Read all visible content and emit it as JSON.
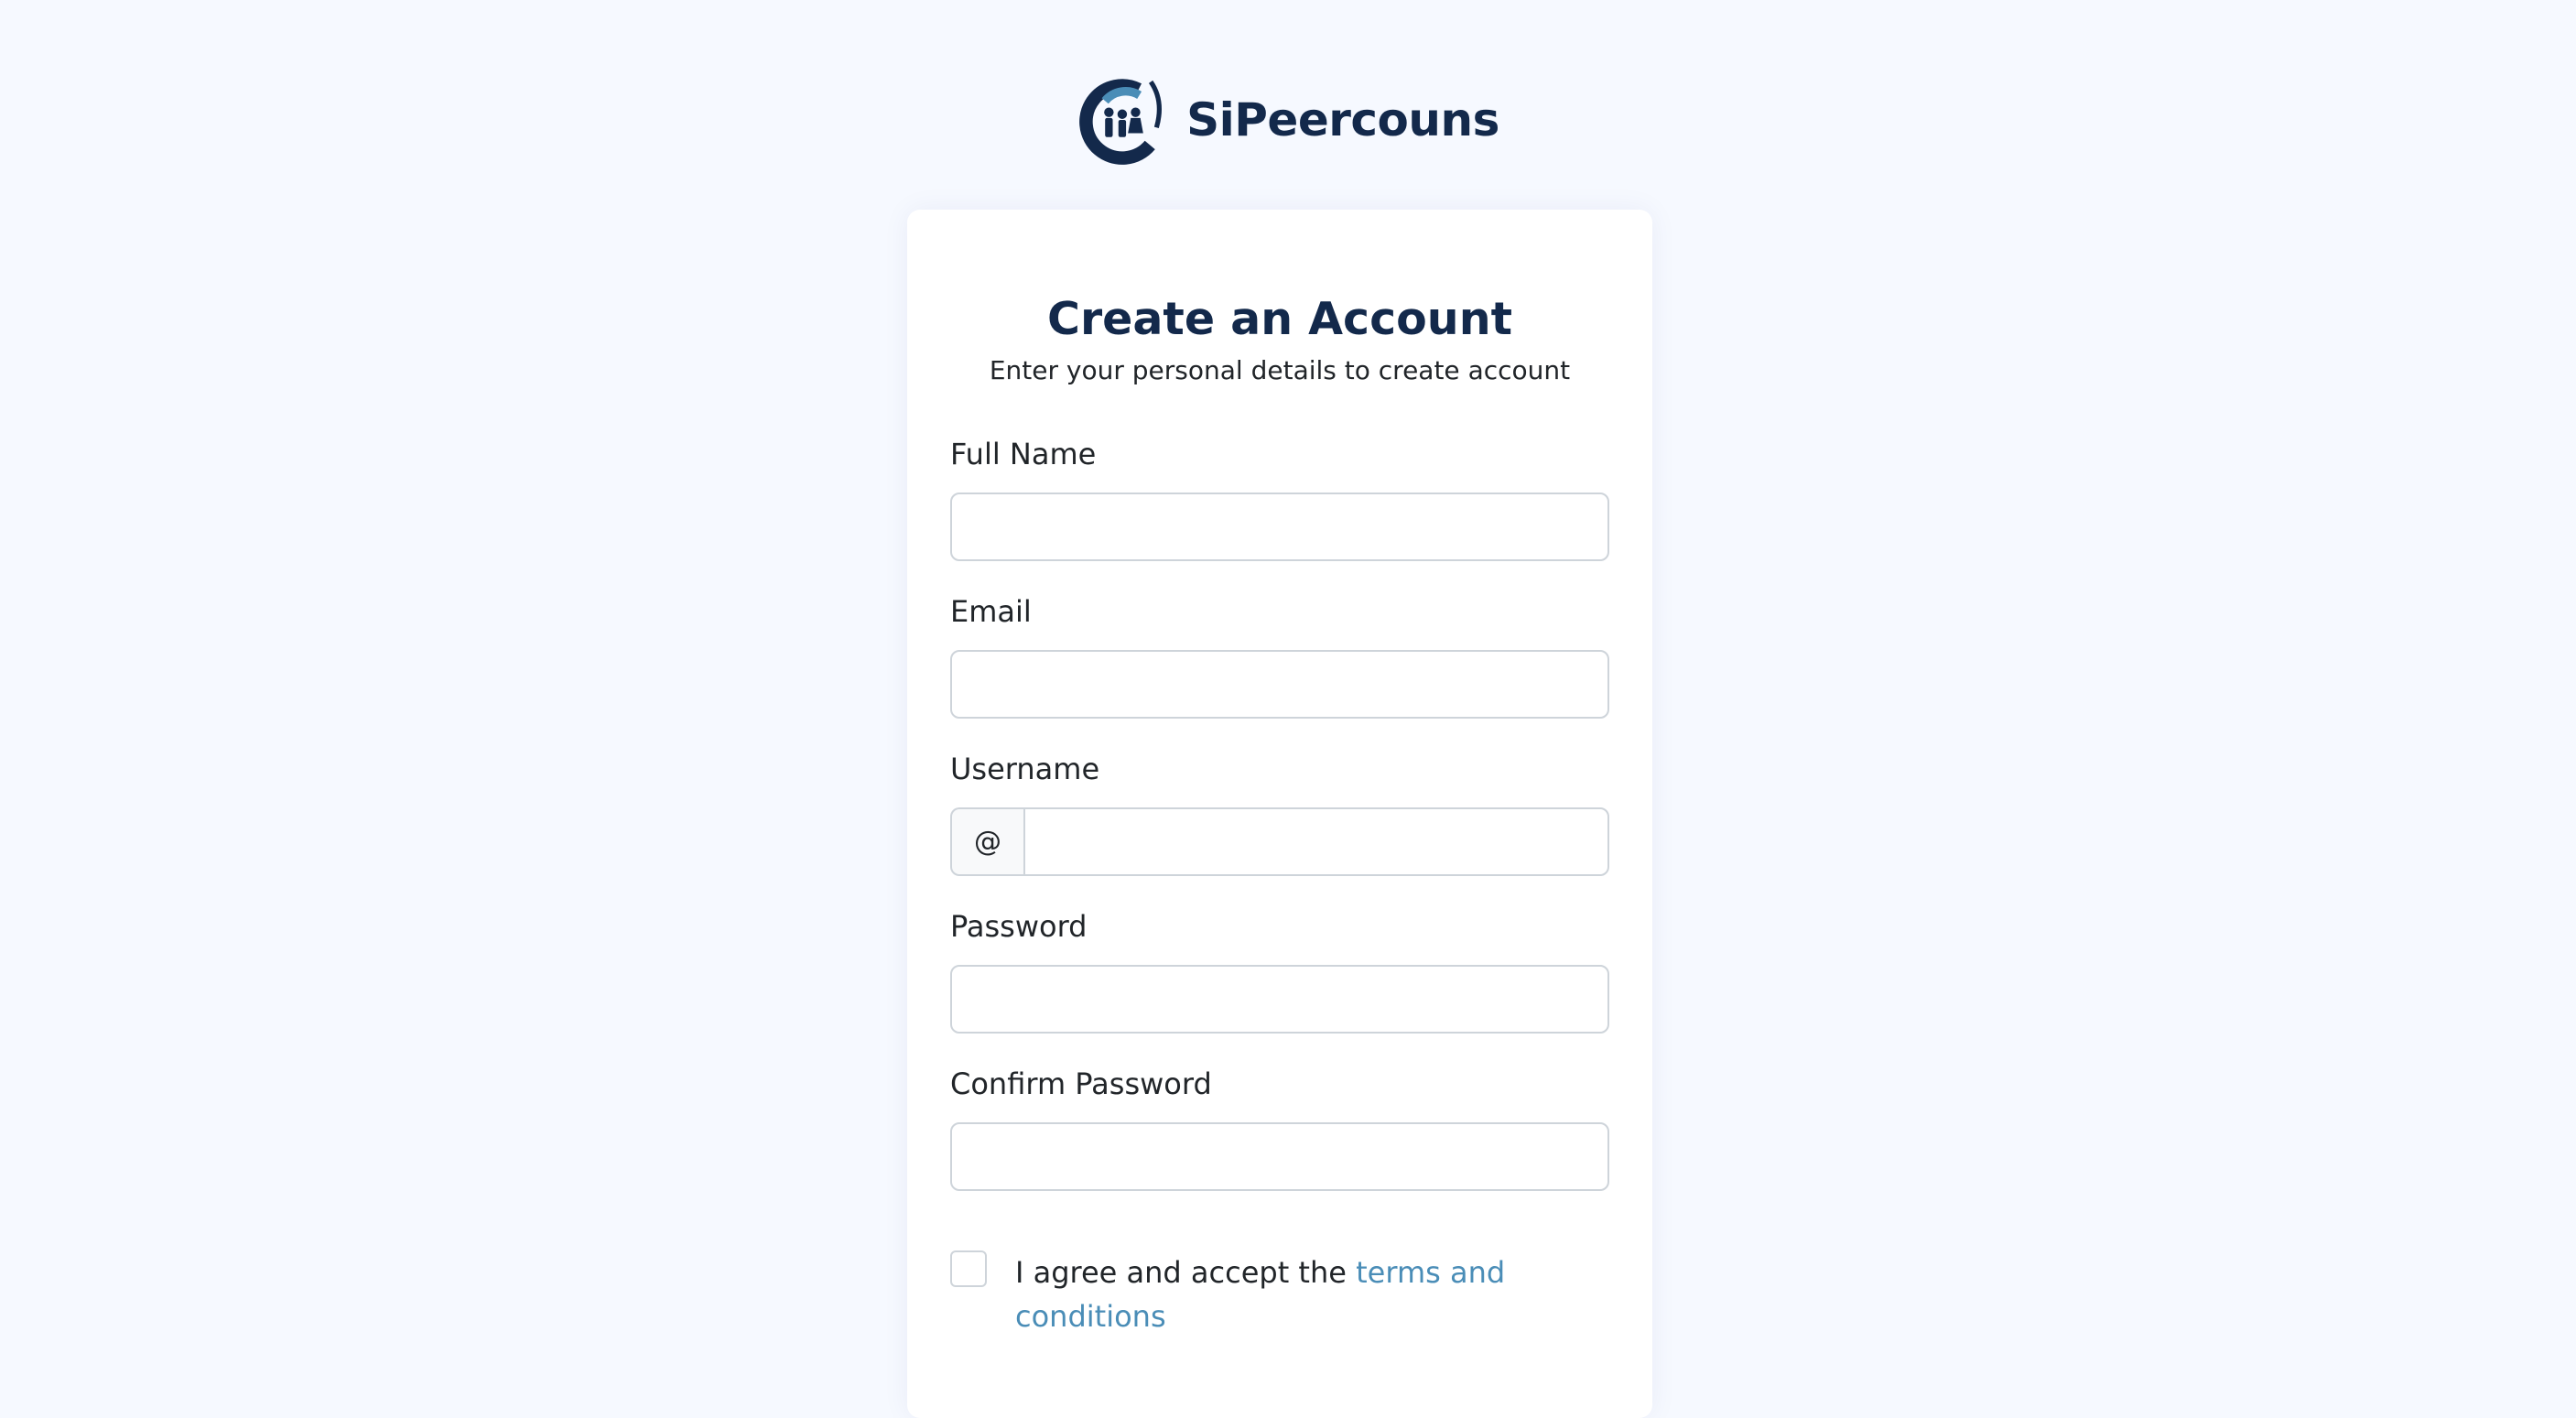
{
  "brand": {
    "name": "SiPeercouns",
    "logo_icon": "family-circle-logo-icon",
    "colors": {
      "primary": "#13294b",
      "accent": "#4a8db7"
    }
  },
  "form": {
    "title": "Create an Account",
    "subtitle": "Enter your personal details to create account",
    "fields": {
      "full_name": {
        "label": "Full Name",
        "value": ""
      },
      "email": {
        "label": "Email",
        "value": ""
      },
      "username": {
        "label": "Username",
        "prefix": "@",
        "value": ""
      },
      "password": {
        "label": "Password",
        "value": ""
      },
      "confirm_password": {
        "label": "Confirm Password",
        "value": ""
      }
    },
    "terms": {
      "checked": false,
      "text": "I agree and accept the",
      "link_text": "terms and conditions"
    }
  }
}
